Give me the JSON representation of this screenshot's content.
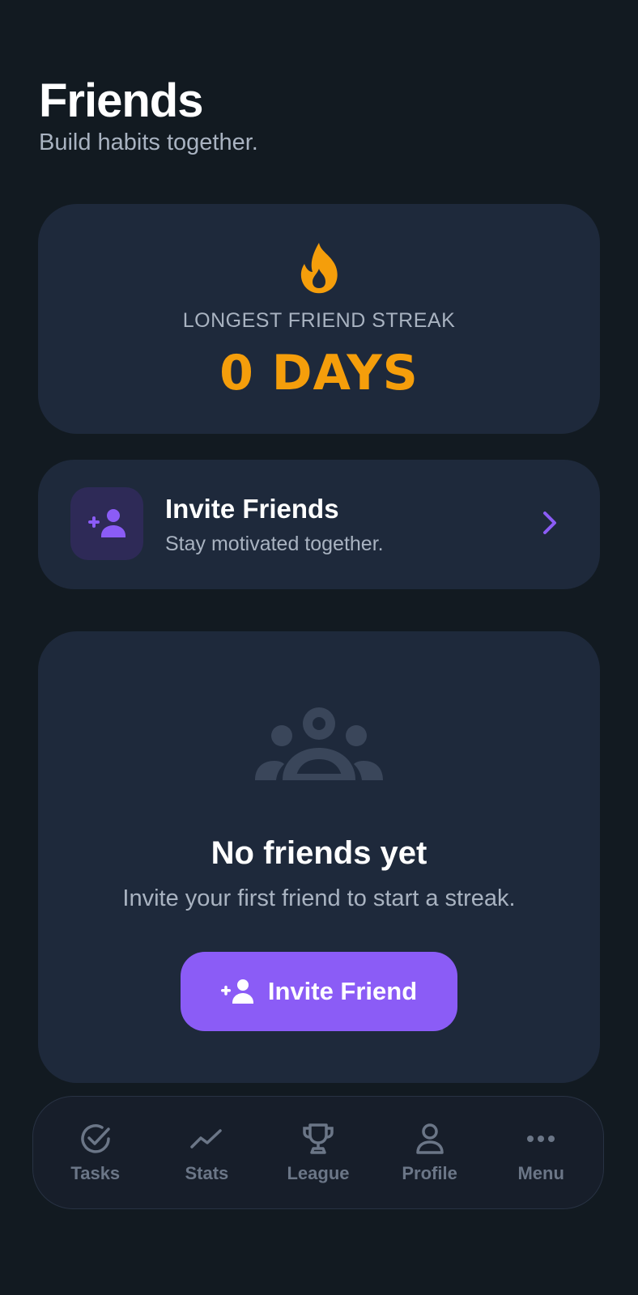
{
  "header": {
    "title": "Friends",
    "subtitle": "Build habits together."
  },
  "streak": {
    "icon": "flame-icon",
    "label": "LONGEST FRIEND STREAK",
    "value": "0 DAYS"
  },
  "invite_row": {
    "icon": "add-user-icon",
    "title": "Invite Friends",
    "subtitle": "Stay motivated together."
  },
  "empty_state": {
    "icon": "group-icon",
    "title": "No friends yet",
    "subtitle": "Invite your first friend to start a streak.",
    "button_label": "Invite Friend"
  },
  "bottom_nav": {
    "items": [
      {
        "label": "Tasks",
        "icon": "check-circle-icon"
      },
      {
        "label": "Stats",
        "icon": "trend-line-icon"
      },
      {
        "label": "League",
        "icon": "trophy-icon"
      },
      {
        "label": "Profile",
        "icon": "person-icon"
      },
      {
        "label": "Menu",
        "icon": "more-dots-icon"
      }
    ]
  },
  "colors": {
    "background": "#121a21",
    "card": "#1e293b",
    "accent_purple": "#8b5cf6",
    "accent_orange": "#f59e0b",
    "muted_text": "#a9b3c1",
    "nav_text": "#6b7687"
  }
}
